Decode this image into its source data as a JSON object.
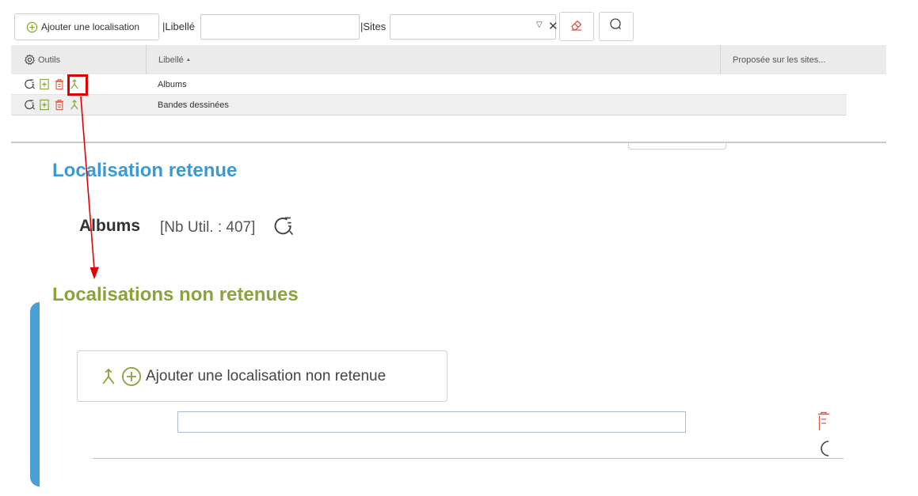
{
  "toolbar": {
    "add_label": "Ajouter une localisation",
    "libelle_label": "|Libellé",
    "libelle_value": "",
    "sites_label": "|Sites",
    "sites_value": ""
  },
  "grid": {
    "columns": [
      "Outils",
      "Libellé",
      "Proposée sur les sites..."
    ],
    "sort_indicator": "▲",
    "rows": [
      {
        "label": "Albums"
      },
      {
        "label": "Bandes dessinées"
      }
    ]
  },
  "retenue": {
    "title": "Localisation retenue",
    "name": "Albums",
    "count_text": "[Nb Util. : 407]"
  },
  "non_retenues": {
    "title": "Localisations non retenues",
    "add_label": "Ajouter une localisation non retenue",
    "input_value": ""
  },
  "colors": {
    "accent_blue": "#3b9ad6",
    "accent_green": "#8aa33c",
    "danger_red": "#e00000",
    "icon_green": "#8aa33c",
    "icon_red": "#e05a4a"
  },
  "icons": {
    "add": "plus-circle-icon",
    "erase": "eraser-icon",
    "search": "search-icon",
    "settings": "gear-icon",
    "row_history": "history-icon",
    "row_add": "add-document-icon",
    "row_delete": "trash-icon",
    "row_merge": "merge-icon"
  }
}
